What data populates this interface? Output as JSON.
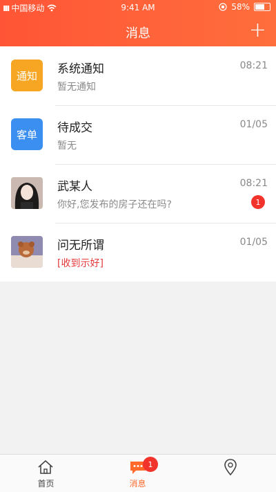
{
  "status_bar": {
    "carrier": "中国移动",
    "time": "9:41 AM",
    "battery": "58%"
  },
  "header": {
    "title": "消息"
  },
  "messages": [
    {
      "name": "系统通知",
      "preview": "暂无通知",
      "time": "08:21",
      "icon_label": "通知",
      "icon_color": "#f6a623"
    },
    {
      "name": "待成交",
      "preview": "暂无",
      "time": "01/05",
      "icon_label": "客单",
      "icon_color": "#3a8ff0"
    },
    {
      "name": "武某人",
      "preview": "你好,您发布的房子还在吗?",
      "time": "08:21",
      "badge": "1"
    },
    {
      "name": "问无所谓",
      "preview": "[收到示好]",
      "time": "01/05"
    }
  ],
  "tabbar": {
    "tabs": [
      {
        "label": "首页",
        "icon": "home-icon"
      },
      {
        "label": "消息",
        "icon": "message-icon",
        "badge": "1"
      },
      {
        "label": "",
        "icon": "location-icon"
      }
    ]
  },
  "colors": {
    "accent": "#ff5a36",
    "badge": "#f2332c"
  }
}
